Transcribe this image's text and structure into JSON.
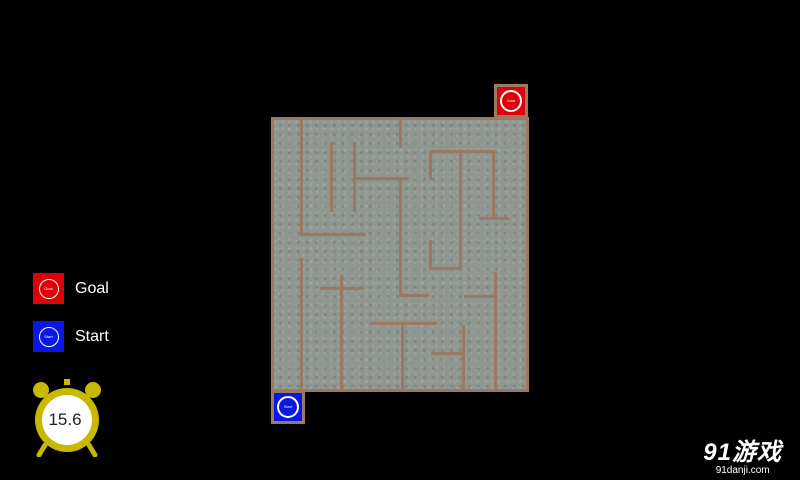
{
  "maze": {
    "goal_label": "Goal",
    "start_label": "Start",
    "wall_color": "#9a7b62",
    "floor_color": "#8f958f"
  },
  "legend": {
    "goal": {
      "label": "Goal",
      "badge": "Goal",
      "color": "#e0000a"
    },
    "start": {
      "label": "Start",
      "badge": "Start",
      "color": "#0a17e6"
    }
  },
  "timer": {
    "value": "15.6",
    "color": "#c9b800"
  },
  "watermark": {
    "logo": "91游戏",
    "site": "91danji.com"
  }
}
